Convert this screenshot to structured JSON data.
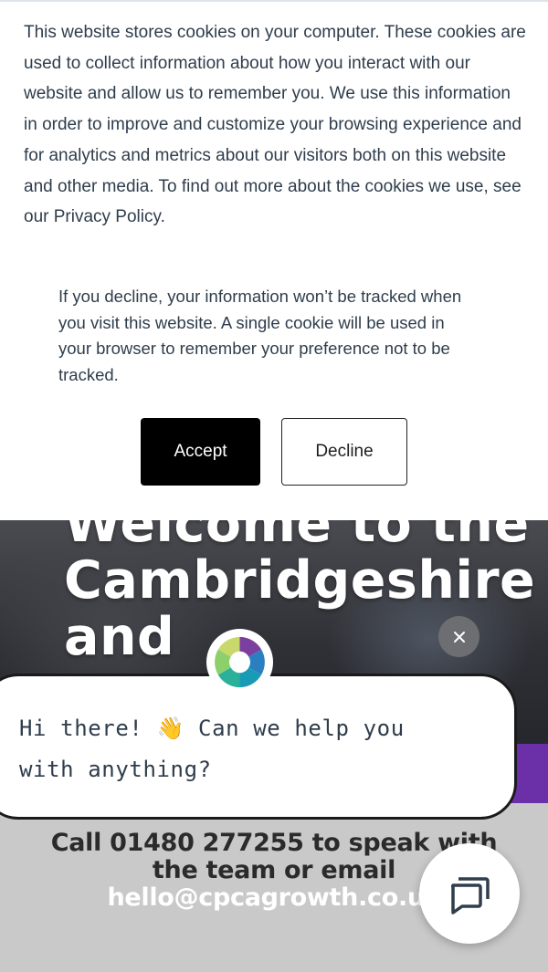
{
  "cookie_banner": {
    "message": "This website stores cookies on your computer. These cookies are used to collect information about how you interact with our website and allow us to remember you. We use this information in order to improve and customize your browsing experience and for analytics and metrics about our visitors both on this website and other media. To find out more about the cookies we use, see our Privacy Policy.",
    "decline_info": "If you decline, your information won’t be tracked when you visit this website. A single cookie will be used in your browser to remember your preference not to be tracked.",
    "accept_label": "Accept",
    "decline_label": "Decline"
  },
  "hero": {
    "title": "Welcome to the\nCambridgeshire\nand"
  },
  "contact": {
    "lead": "Call 01480 277255 to speak with the team or email ",
    "email": "hello@cpcagrowth.co.uk"
  },
  "chat": {
    "greeting": "Hi there! 👋 Can we help you with anything?",
    "close_icon": "close-icon",
    "launcher_icon": "chat-icon"
  },
  "colors": {
    "text_dark": "#2f3d4c",
    "hero_accent": "#6b2fa8",
    "close_bg": "#6d6e72"
  }
}
